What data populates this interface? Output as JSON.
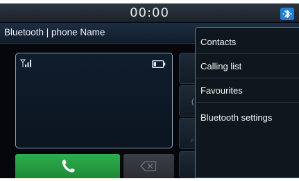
{
  "status_bar": {
    "time": "00:00",
    "icons": {
      "bluetooth": "bluetooth-icon"
    }
  },
  "header": {
    "title": "Bluetooth | phone Name"
  },
  "phone_panel": {
    "icons": {
      "signal": "signal-strength-icon",
      "battery": "battery-icon"
    }
  },
  "actions": {
    "call_icon": "phone-handset-icon",
    "delete_icon": "backspace-icon",
    "call_color": "#25a043"
  },
  "menu": {
    "items": [
      {
        "label": "Contacts"
      },
      {
        "label": "Calling list"
      },
      {
        "label": "Favourites"
      },
      {
        "label": "Bluetooth settings"
      }
    ]
  },
  "colors": {
    "bluetooth_badge": "#1f7fd6",
    "background": "#05070b",
    "panel_border": "#8aa2bb"
  }
}
